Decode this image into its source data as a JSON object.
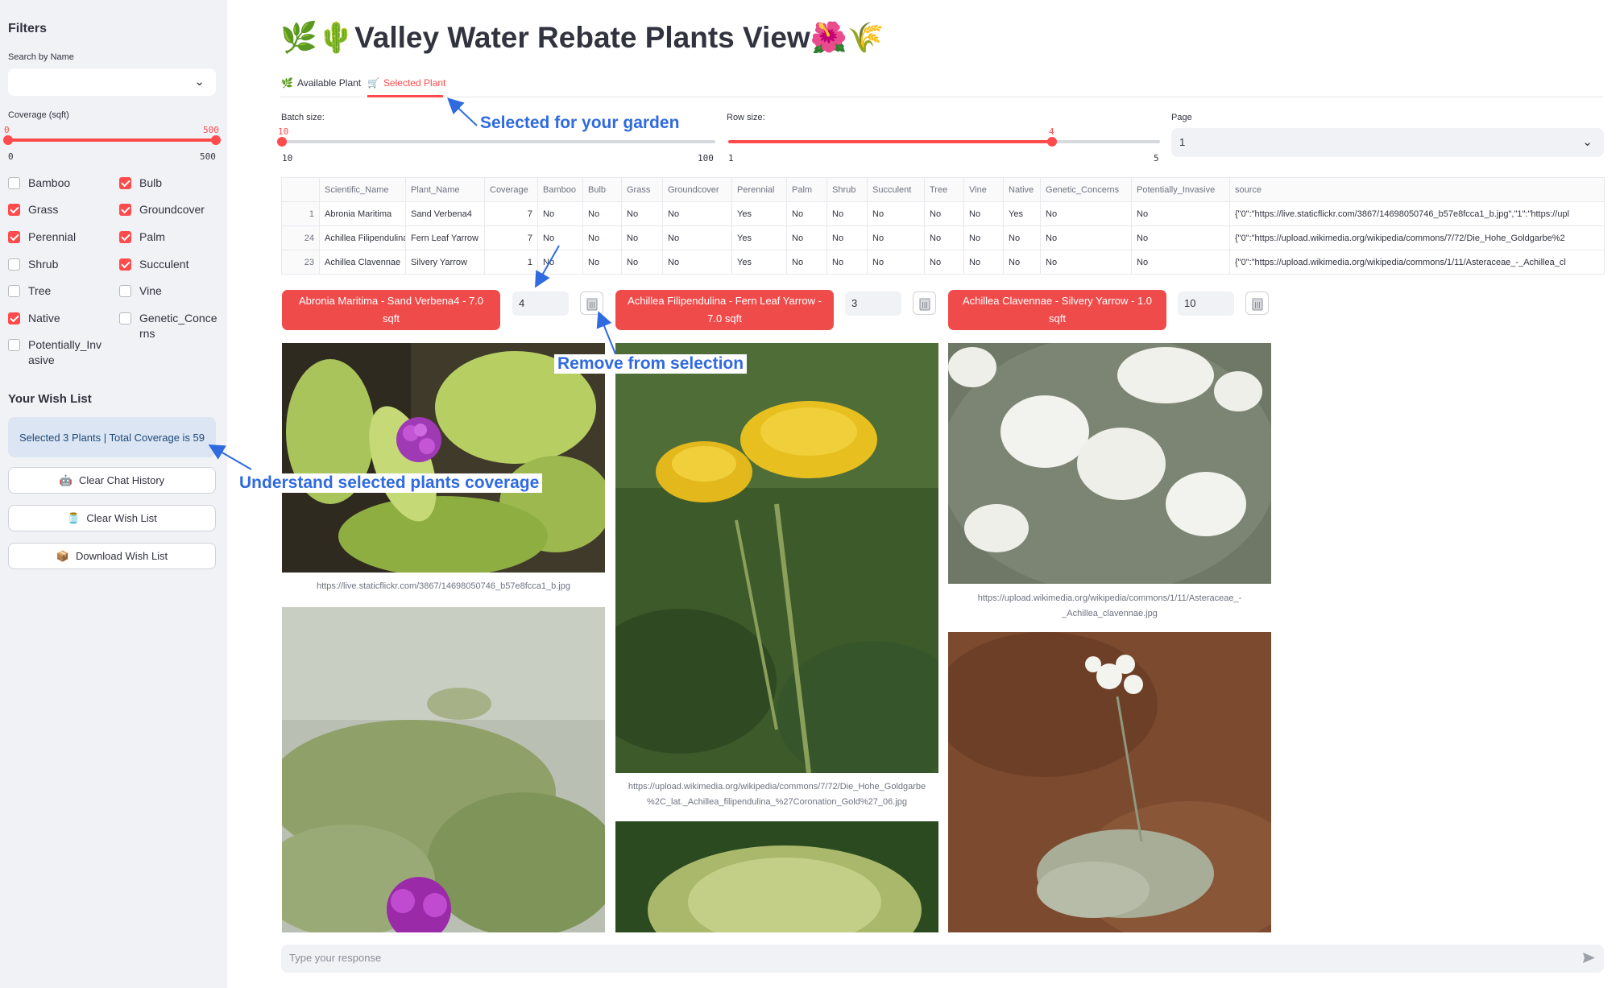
{
  "sidebar": {
    "filters_heading": "Filters",
    "search_label": "Search by Name",
    "search_value": "",
    "coverage_label": "Coverage (sqft)",
    "coverage_low": "0",
    "coverage_high": "500",
    "coverage_min": "0",
    "coverage_max": "500",
    "coverage_range": [
      0,
      500
    ],
    "checkboxes_left": [
      {
        "label": "Bamboo",
        "checked": false
      },
      {
        "label": "Grass",
        "checked": true
      },
      {
        "label": "Perennial",
        "checked": true
      },
      {
        "label": "Shrub",
        "checked": false
      },
      {
        "label": "Tree",
        "checked": false
      },
      {
        "label": "Native",
        "checked": true
      },
      {
        "label": "Potentially_Inv\nasive",
        "checked": false
      }
    ],
    "checkboxes_right": [
      {
        "label": "Bulb",
        "checked": true
      },
      {
        "label": "Groundcover",
        "checked": true
      },
      {
        "label": "Palm",
        "checked": true
      },
      {
        "label": "Succulent",
        "checked": true
      },
      {
        "label": "Vine",
        "checked": false
      },
      {
        "label": "Genetic_Conce\nrns",
        "checked": false
      }
    ],
    "wishlist_heading": "Your Wish List",
    "wishlist_info": "Selected 3 Plants | Total Coverage is 59",
    "buttons": [
      {
        "icon": "robot-icon",
        "label": "Clear Chat History"
      },
      {
        "icon": "jar-icon",
        "label": "Clear Wish List"
      },
      {
        "icon": "box-icon",
        "label": "Download Wish List"
      }
    ]
  },
  "main": {
    "title": "🌿🌵Valley Water Rebate Plants View🌺🌾",
    "tabs": [
      {
        "icon": "🌿",
        "label": "Available Plant",
        "active": false
      },
      {
        "icon": "🛒",
        "label": "Selected Plant",
        "active": true
      }
    ],
    "batch": {
      "label": "Batch size:",
      "value": "10",
      "min": "10",
      "max": "100",
      "fraction": 0.0
    },
    "row": {
      "label": "Row size:",
      "value": "4",
      "min": "1",
      "max": "5",
      "fraction": 0.75
    },
    "page": {
      "label": "Page",
      "value": "1"
    },
    "table": {
      "columns": [
        "",
        "Scientific_Name",
        "Plant_Name",
        "Coverage",
        "Bamboo",
        "Bulb",
        "Grass",
        "Groundcover",
        "Perennial",
        "Palm",
        "Shrub",
        "Succulent",
        "Tree",
        "Vine",
        "Native",
        "Genetic_Concerns",
        "Potentially_Invasive",
        "source"
      ],
      "rows": [
        [
          "1",
          "Abronia Maritima",
          "Sand Verbena4",
          "7",
          "No",
          "No",
          "No",
          "No",
          "Yes",
          "No",
          "No",
          "No",
          "No",
          "No",
          "Yes",
          "No",
          "No",
          "{\"0\":\"https://live.staticflickr.com/3867/14698050746_b57e8fcca1_b.jpg\",\"1\":\"https://upl"
        ],
        [
          "24",
          "Achillea Filipendulina",
          "Fern Leaf Yarrow",
          "7",
          "No",
          "No",
          "No",
          "No",
          "Yes",
          "No",
          "No",
          "No",
          "No",
          "No",
          "No",
          "No",
          "No",
          "{\"0\":\"https://upload.wikimedia.org/wikipedia/commons/7/72/Die_Hohe_Goldgarbe%2"
        ],
        [
          "23",
          "Achillea Clavennae",
          "Silvery Yarrow",
          "1",
          "No",
          "No",
          "No",
          "No",
          "Yes",
          "No",
          "No",
          "No",
          "No",
          "No",
          "No",
          "No",
          "No",
          "{\"0\":\"https://upload.wikimedia.org/wikipedia/commons/1/11/Asteraceae_-_Achillea_cl"
        ]
      ]
    },
    "selections": [
      {
        "label": "Abronia Maritima - Sand Verbena4 - 7.0 sqft",
        "qty": "4"
      },
      {
        "label": "Achillea Filipendulina - Fern Leaf Yarrow - 7.0 sqft",
        "qty": "3"
      },
      {
        "label": "Achillea Clavennae - Silvery Yarrow - 1.0 sqft",
        "qty": "10"
      }
    ],
    "captions": [
      "https://live.staticflickr.com/3867/14698050746_b57e8fcca1_b.jpg",
      "https://upload.wikimedia.org/wikipedia/commons/7/72/Die_Hohe_Goldgarbe\n%2C_lat._Achillea_filipendulina_%27Coronation_Gold%27_06.jpg",
      "https://upload.wikimedia.org/wikipedia/commons/1/11/Asteraceae_-\n_Achillea_clavennae.jpg"
    ],
    "chat_placeholder": "Type your response"
  },
  "annotations": {
    "selected": "Selected for your garden",
    "remove": "Remove from selection",
    "coverage": "Understand selected plants coverage"
  },
  "colors": {
    "accent": "#ff4b4b",
    "annotation": "#2f6ae0",
    "sidebar_bg": "#f0f2f6"
  }
}
